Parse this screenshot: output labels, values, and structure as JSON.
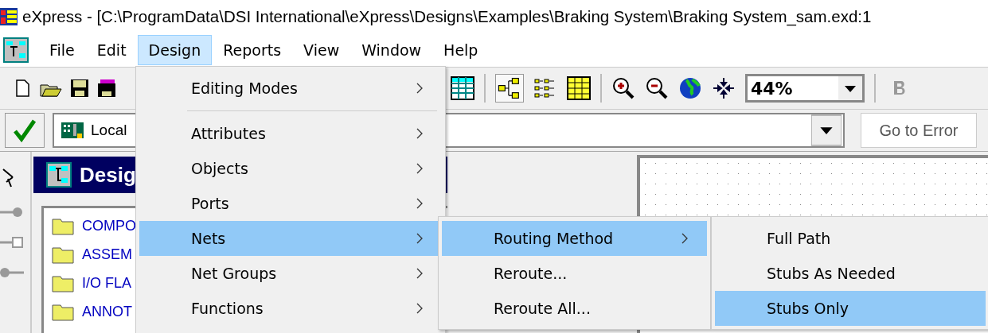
{
  "window": {
    "title": "eXpress - [C:\\ProgramData\\DSI International\\eXpress\\Designs\\Examples\\Braking System\\Braking System_sam.exd:1"
  },
  "menu_bar": [
    {
      "label": "File",
      "selected": false
    },
    {
      "label": "Edit",
      "selected": false
    },
    {
      "label": "Design",
      "selected": true
    },
    {
      "label": "Reports",
      "selected": false
    },
    {
      "label": "View",
      "selected": false
    },
    {
      "label": "Window",
      "selected": false
    },
    {
      "label": "Help",
      "selected": false
    }
  ],
  "toolbar": {
    "zoom": "44%"
  },
  "error_bar": {
    "scope": "Local",
    "button": "Go to Error"
  },
  "design_panel": {
    "title": "Desig",
    "items": [
      "COMPO",
      "ASSEM",
      "I/O FLA",
      "ANNOT"
    ]
  },
  "menus": [
    {
      "items": [
        {
          "label": "Editing Modes",
          "submenu": true,
          "selected": false,
          "separator_after": true
        },
        {
          "label": "Attributes",
          "submenu": true,
          "selected": false
        },
        {
          "label": "Objects",
          "submenu": true,
          "selected": false
        },
        {
          "label": "Ports",
          "submenu": true,
          "selected": false
        },
        {
          "label": "Nets",
          "submenu": true,
          "selected": true
        },
        {
          "label": "Net Groups",
          "submenu": true,
          "selected": false
        },
        {
          "label": "Functions",
          "submenu": true,
          "selected": false
        }
      ]
    },
    {
      "items": [
        {
          "label": "Routing Method",
          "submenu": true,
          "selected": true
        },
        {
          "label": "Reroute...",
          "submenu": false,
          "selected": false
        },
        {
          "label": "Reroute All...",
          "submenu": false,
          "selected": false
        }
      ]
    },
    {
      "items": [
        {
          "label": "Full Path",
          "submenu": false,
          "selected": false
        },
        {
          "label": "Stubs As Needed",
          "submenu": false,
          "selected": false
        },
        {
          "label": "Stubs Only",
          "submenu": false,
          "selected": true
        }
      ]
    }
  ]
}
